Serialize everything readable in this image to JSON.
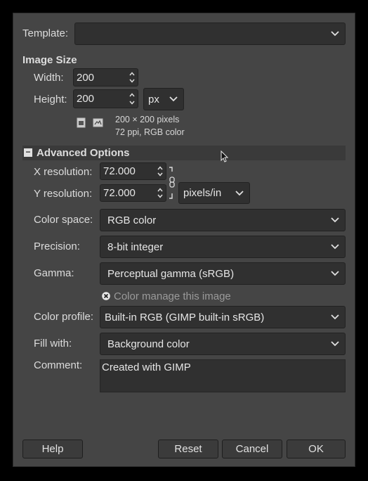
{
  "template": {
    "label": "Template:",
    "value": ""
  },
  "image_size": {
    "heading": "Image Size",
    "width_label": "Width:",
    "width_value": "200",
    "height_label": "Height:",
    "height_value": "200",
    "unit": "px",
    "info_line1": "200 × 200 pixels",
    "info_line2": "72 ppi, RGB color"
  },
  "advanced": {
    "toggle": "−",
    "heading": "Advanced Options",
    "x_res_label": "X resolution:",
    "x_res_value": "72.000",
    "y_res_label": "Y resolution:",
    "y_res_value": "72.000",
    "res_unit": "pixels/in",
    "color_space_label": "Color space:",
    "color_space_value": "RGB color",
    "precision_label": "Precision:",
    "precision_value": "8-bit integer",
    "gamma_label": "Gamma:",
    "gamma_value": "Perceptual gamma (sRGB)",
    "color_manage_label": "Color manage this image",
    "color_manage_checked": true,
    "color_profile_label": "Color profile:",
    "color_profile_value": "Built-in RGB (GIMP built-in sRGB)",
    "fill_label": "Fill with:",
    "fill_value": "Background color",
    "comment_label": "Comment:",
    "comment_value": "Created with GIMP"
  },
  "buttons": {
    "help": "Help",
    "reset": "Reset",
    "cancel": "Cancel",
    "ok": "OK"
  },
  "colors": {
    "dialog_bg": "#454545",
    "field_bg": "#303030",
    "section_bg": "#3a3a3a"
  }
}
